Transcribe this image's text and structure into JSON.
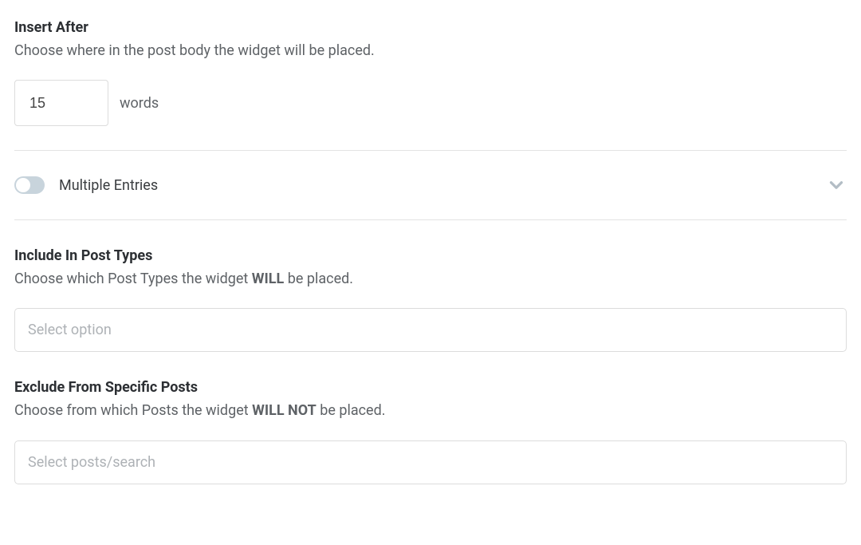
{
  "insert_after": {
    "title": "Insert After",
    "desc": "Choose where in the post body the widget will be placed.",
    "value": "15",
    "unit": "words"
  },
  "multiple_entries": {
    "label": "Multiple Entries",
    "enabled": false
  },
  "include": {
    "title": "Include In Post Types",
    "desc_before": "Choose which Post Types the widget ",
    "desc_strong": "WILL",
    "desc_after": " be placed.",
    "placeholder": "Select option"
  },
  "exclude": {
    "title": "Exclude From Specific Posts",
    "desc_before": "Choose from which Posts the widget ",
    "desc_strong": "WILL NOT",
    "desc_after": " be placed.",
    "placeholder": "Select posts/search"
  }
}
